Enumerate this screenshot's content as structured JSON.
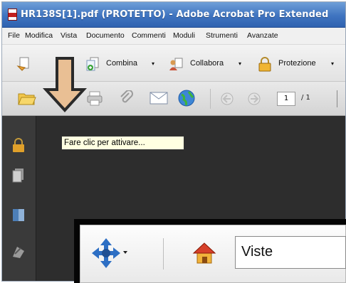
{
  "window": {
    "title": "HR138S[1].pdf (PROTETTO) - Adobe Acrobat Pro Extended"
  },
  "menu": {
    "items": [
      "File",
      "Modifica",
      "Vista",
      "Documento",
      "Commenti",
      "Moduli",
      "Strumenti",
      "Avanzate"
    ]
  },
  "tasks_toolbar": {
    "combine_label": "Combina",
    "collaborate_label": "Collabora",
    "protection_label": "Protezione",
    "dropdown_glyph": "▾"
  },
  "nav_toolbar": {
    "current_page": "1",
    "total_pages": "/ 1"
  },
  "tooltip": {
    "text": "Fare clic per attivare..."
  },
  "flash_panel": {
    "views_label": "Viste"
  },
  "colors": {
    "title_bar": "#3f74c0",
    "document_background": "#2d2d2d",
    "tooltip_background": "#ffffe1"
  },
  "icons": [
    "pdf-icon",
    "create-pdf-icon",
    "combine-icon",
    "collaborate-icon",
    "lock-icon",
    "folder-open-icon",
    "printer-icon",
    "attach-icon",
    "email-icon",
    "globe-icon",
    "previous-page-icon",
    "next-page-icon",
    "annotation-arrow-icon",
    "navigation-move-icon",
    "home-icon"
  ]
}
